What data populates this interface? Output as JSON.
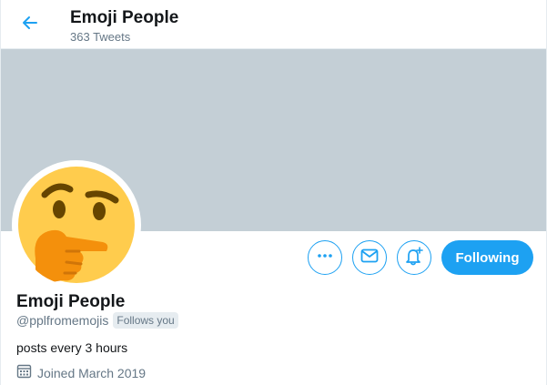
{
  "header": {
    "title": "Emoji People",
    "tweet_count": "363 Tweets",
    "back_icon": "arrow-left-icon"
  },
  "banner": {
    "color": "#c4cfd6"
  },
  "avatar": {
    "emoji": "thinking-face",
    "icon": "thinking-face-icon"
  },
  "actions": {
    "more_icon": "more-icon",
    "message_icon": "mail-icon",
    "notifications_icon": "bell-plus-icon",
    "following_label": "Following"
  },
  "profile": {
    "name": "Emoji People",
    "handle": "@pplfromemojis",
    "follows_you": "Follows you",
    "bio": "posts every 3 hours",
    "joined": "Joined March 2019",
    "calendar_icon": "calendar-icon"
  },
  "colors": {
    "accent": "#1da1f2",
    "text_primary": "#14171a",
    "text_secondary": "#657786"
  }
}
